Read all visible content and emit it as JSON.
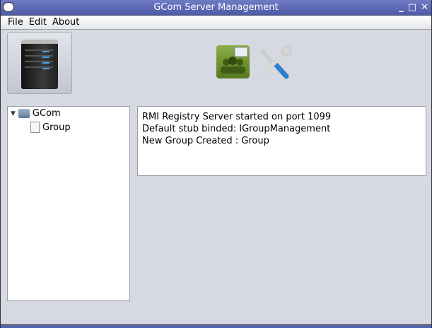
{
  "window": {
    "title": "GCom Server Management",
    "controls": [
      "_",
      "□",
      "✕"
    ]
  },
  "menu": [
    "File",
    "Edit",
    "About"
  ],
  "toolbar": {
    "server_icon": "server-icon",
    "contacts_icon": "group-contacts-icon",
    "tools_icon": "settings-tools-icon"
  },
  "tree": {
    "root": "GCom",
    "children": [
      "Group"
    ]
  },
  "log": [
    "RMI Registry Server started on port 1099",
    "Default stub binded: IGroupManagement",
    "New Group Created : Group"
  ]
}
